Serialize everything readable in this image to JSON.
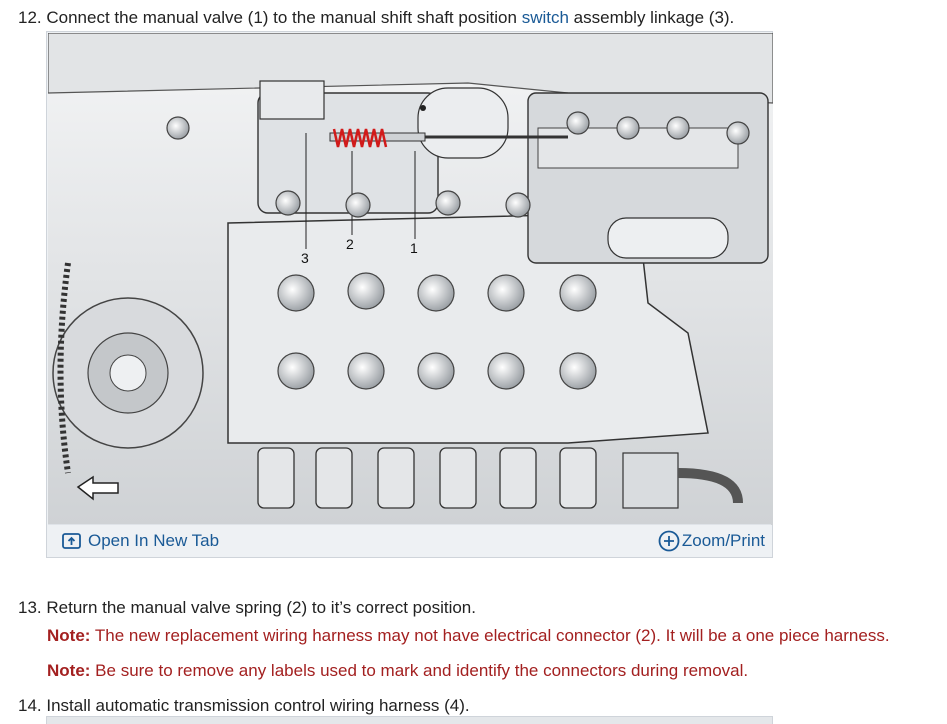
{
  "step12": {
    "number": "12.",
    "text_before": "Connect the manual valve (1) to the manual shift shaft position ",
    "link": "switch",
    "text_after": " assembly linkage (3)."
  },
  "figure": {
    "callouts": [
      "1",
      "2",
      "3"
    ],
    "open_tab_label": "Open In New Tab",
    "zoom_label": "Zoom/Print"
  },
  "step13": {
    "number": "13.",
    "text": "Return the manual valve spring (2) to it’s correct position."
  },
  "notes": [
    {
      "label": "Note:",
      "text": " The new replacement wiring harness may not have electrical connector (2). It will be a one piece harness."
    },
    {
      "label": "Note:",
      "text": " Be sure to remove any labels used to mark and identify the connectors during removal."
    }
  ],
  "step14": {
    "number": "14.",
    "text": "Install automatic transmission control wiring harness (4)."
  },
  "colors": {
    "link": "#1a5a96",
    "note": "#a32020",
    "spring": "#d11a1a"
  }
}
